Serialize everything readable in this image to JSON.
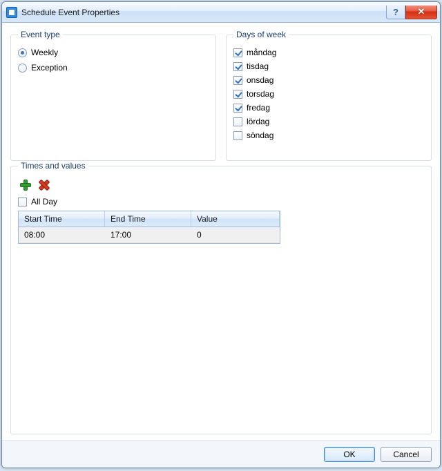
{
  "window": {
    "title": "Schedule Event Properties"
  },
  "event_type": {
    "legend": "Event type",
    "options": [
      {
        "label": "Weekly",
        "selected": true
      },
      {
        "label": "Exception",
        "selected": false
      }
    ]
  },
  "days": {
    "legend": "Days of week",
    "items": [
      {
        "label": "måndag",
        "checked": true
      },
      {
        "label": "tisdag",
        "checked": true
      },
      {
        "label": "onsdag",
        "checked": true
      },
      {
        "label": "torsdag",
        "checked": true
      },
      {
        "label": "fredag",
        "checked": true
      },
      {
        "label": "lördag",
        "checked": false
      },
      {
        "label": "söndag",
        "checked": false
      }
    ]
  },
  "times": {
    "legend": "Times and values",
    "all_day_label": "All Day",
    "all_day_checked": false,
    "columns": {
      "start": "Start Time",
      "end": "End Time",
      "value": "Value"
    },
    "rows": [
      {
        "start": "08:00",
        "end": "17:00",
        "value": "0"
      }
    ]
  },
  "footer": {
    "ok": "OK",
    "cancel": "Cancel"
  }
}
